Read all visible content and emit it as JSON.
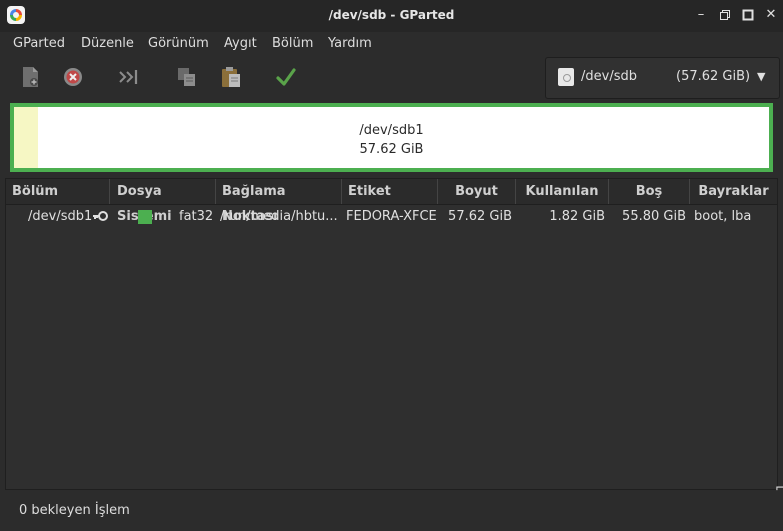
{
  "window": {
    "title": "/dev/sdb - GParted"
  },
  "window_controls": {
    "minimize": "–",
    "maximize": "□",
    "close": "✕"
  },
  "menu": [
    "GParted",
    "Düzenle",
    "Görünüm",
    "Aygıt",
    "Bölüm",
    "Yardım"
  ],
  "toolbar": {
    "buttons": [
      {
        "name": "new-partition",
        "icon": "new-document-icon"
      },
      {
        "name": "delete-partition",
        "icon": "delete-icon"
      },
      {
        "name": "resize-move",
        "icon": "resize-move-icon"
      },
      {
        "name": "copy",
        "icon": "copy-icon"
      },
      {
        "name": "paste",
        "icon": "paste-icon"
      },
      {
        "name": "apply",
        "icon": "checkmark-icon"
      }
    ]
  },
  "device": {
    "name": "/dev/sdb",
    "size": "(57.62 GiB)"
  },
  "graph": {
    "partition": "/dev/sdb1",
    "size": "57.62 GiB",
    "used_fraction": 0.032,
    "used_color": "#f6f7c4",
    "border_color": "#4caf50"
  },
  "table": {
    "headers": [
      "Bölüm",
      "Dosya Sistemi",
      "Bağlama Noktası",
      "Etiket",
      "Boyut",
      "Kullanılan",
      "Boş",
      "Bayraklar"
    ],
    "rows": [
      {
        "partition": "/dev/sdb1",
        "filesystem": "fat32",
        "filesystem_color": "#4caf50",
        "mountpoint": "/run/media/hbtu...",
        "label": "FEDORA-XFCE",
        "size": "57.62 GiB",
        "used": "1.82 GiB",
        "unused": "55.80 GiB",
        "flags": "boot, lba"
      }
    ]
  },
  "status": {
    "pending": "0 bekleyen İşlem"
  }
}
